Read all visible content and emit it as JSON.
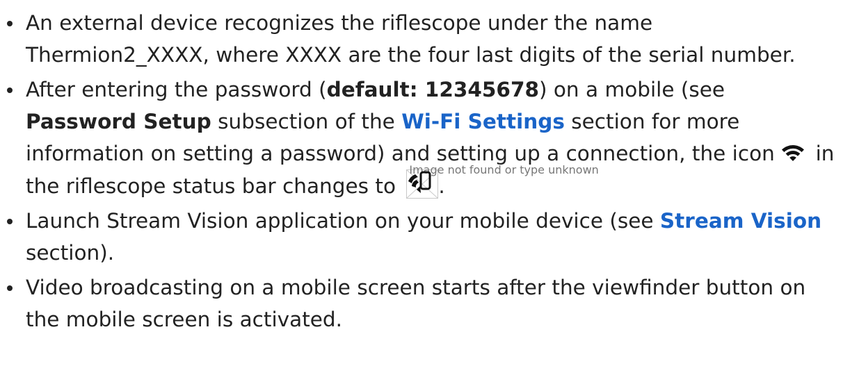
{
  "items": [
    {
      "text": "An external device recognizes the riflescope under the name Thermion2_XXXX, where XXXX are the four last digits of the serial number."
    },
    {
      "t1": "After entering the password (",
      "bold1": "default: 12345678",
      "t2": ") on a mobile (see ",
      "bold2": "Password Setup",
      "t3": " subsection of the ",
      "link1": "Wi-Fi Settings",
      "t4": " section for more information on setting a password) and setting up a connection, the icon ",
      "t5": " in the riflescope status bar changes to ",
      "img_alt": "Image not found or type unknown",
      "t6": "."
    },
    {
      "t1": "Launch Stream Vision application on your mobile device (see ",
      "link1": "Stream Vision",
      "t2": " section)."
    },
    {
      "text": "Video broadcasting on a mobile screen starts after the viewfinder button on the mobile screen is activated."
    }
  ],
  "colors": {
    "text": "#222222",
    "link": "#1a64c8"
  },
  "icons": {
    "wifi": "wifi-icon",
    "connected": "phone-wifi-icon"
  }
}
